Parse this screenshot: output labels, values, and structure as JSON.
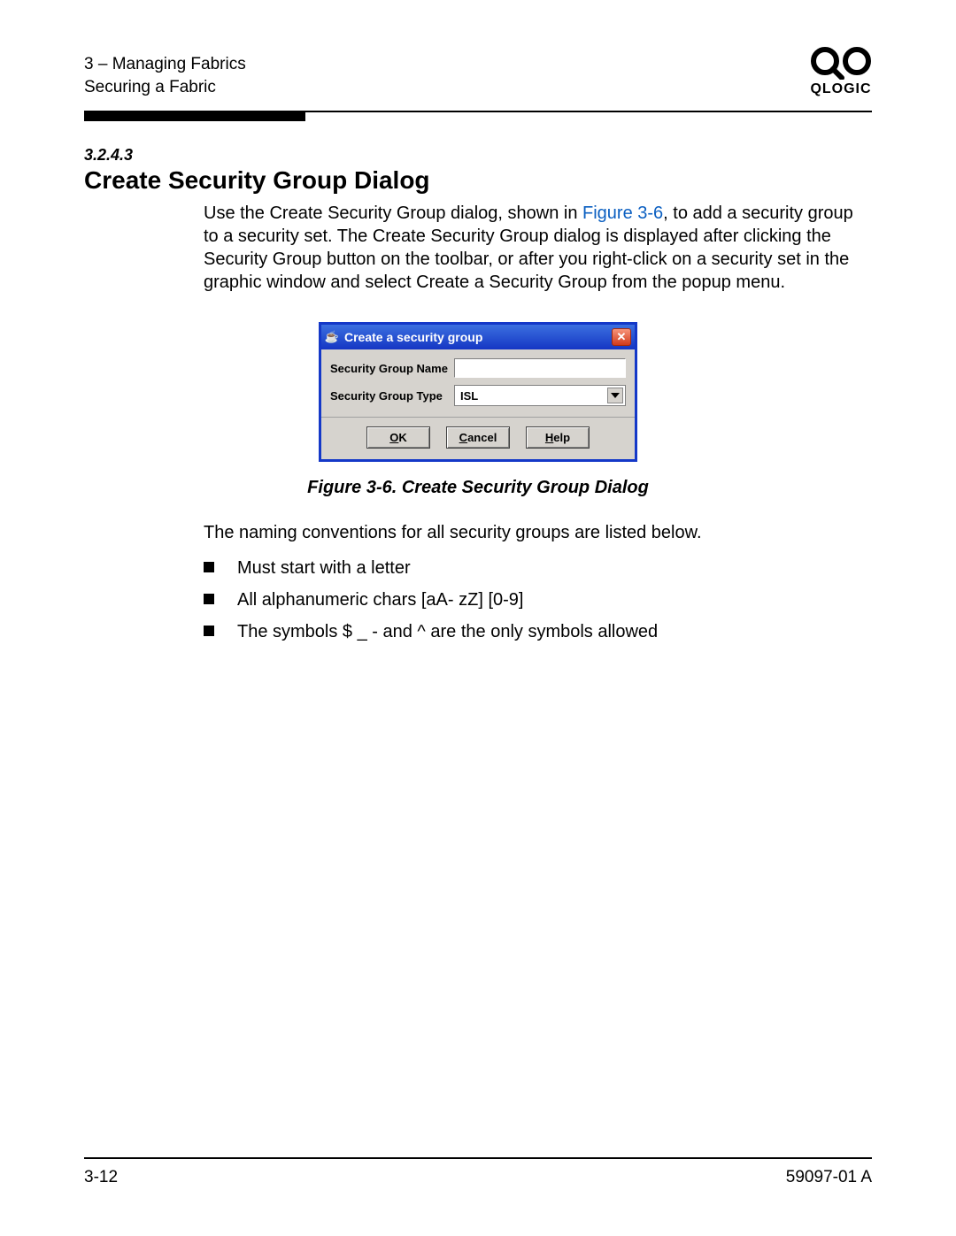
{
  "header": {
    "chapter": "3 – Managing Fabrics",
    "section": "Securing a Fabric",
    "brand": "QLOGIC"
  },
  "content": {
    "section_number": "3.2.4.3",
    "section_title": "Create Security Group Dialog",
    "intro_pre": "Use the Create Security Group dialog, shown in ",
    "intro_figref": "Figure 3-6",
    "intro_post": ", to add a security group to a security set. The Create Security Group dialog is displayed after clicking the Security Group button on the toolbar, or after you right-click on a security set in the graphic window and select Create a Security Group from the popup menu.",
    "figure_caption": "Figure 3-6.  Create Security Group Dialog",
    "naming_intro": "The naming conventions for all security groups are listed below.",
    "bullets": [
      "Must start with a letter",
      "All alphanumeric chars [aA- zZ] [0-9]",
      "The symbols $ _ - and ^ are the only symbols allowed"
    ]
  },
  "dialog": {
    "title": "Create a security group",
    "labels": {
      "name": "Security Group Name",
      "type": "Security Group Type"
    },
    "type_value": "ISL",
    "buttons": {
      "ok": "OK",
      "cancel": "Cancel",
      "help": "Help"
    }
  },
  "footer": {
    "page": "3-12",
    "doc": "59097-01 A"
  }
}
